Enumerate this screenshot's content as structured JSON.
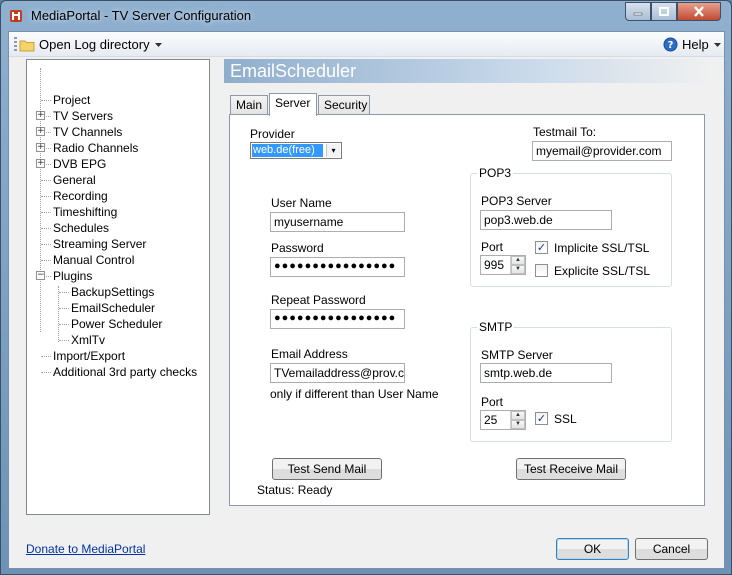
{
  "window": {
    "title": "MediaPortal - TV Server Configuration"
  },
  "menu": {
    "open_log": "Open Log directory",
    "help": "Help"
  },
  "tree": {
    "items": [
      {
        "label": "Project"
      },
      {
        "label": "TV Servers"
      },
      {
        "label": "TV Channels"
      },
      {
        "label": "Radio Channels"
      },
      {
        "label": "DVB EPG"
      },
      {
        "label": "General"
      },
      {
        "label": "Recording"
      },
      {
        "label": "Timeshifting"
      },
      {
        "label": "Schedules"
      },
      {
        "label": "Streaming Server"
      },
      {
        "label": "Manual Control"
      },
      {
        "label": "Plugins"
      },
      {
        "label": "BackupSettings"
      },
      {
        "label": "EmailScheduler"
      },
      {
        "label": "Power Scheduler"
      },
      {
        "label": "XmlTv"
      },
      {
        "label": "Import/Export"
      },
      {
        "label": "Additional 3rd party checks"
      }
    ]
  },
  "header": {
    "title": "EmailScheduler"
  },
  "tabs": [
    "Main",
    "Server",
    "Security"
  ],
  "server": {
    "provider_label": "Provider",
    "provider_value": "web.de(free)",
    "testmail_label": "Testmail To:",
    "testmail_value": "myemail@provider.com",
    "username_label": "User Name",
    "username_value": "myusername",
    "password_label": "Password",
    "password_value": "●●●●●●●●●●●●●●●●",
    "repeat_password_label": "Repeat Password",
    "repeat_password_value": "●●●●●●●●●●●●●●●●",
    "email_label": "Email Address",
    "email_value": "TVemailaddress@prov.com",
    "email_hint": "only if different than User Name",
    "pop3": {
      "group_title": "POP3",
      "server_label": "POP3 Server",
      "server_value": "pop3.web.de",
      "port_label": "Port",
      "port_value": "995",
      "implicit_ssl_label": "Implicite SSL/TSL",
      "implicit_ssl_checked": true,
      "explicit_ssl_label": "Explicite SSL/TSL",
      "explicit_ssl_checked": false
    },
    "smtp": {
      "group_title": "SMTP",
      "server_label": "SMTP Server",
      "server_value": "smtp.web.de",
      "port_label": "Port",
      "port_value": "25",
      "ssl_label": "SSL",
      "ssl_checked": true
    },
    "test_send_label": "Test Send Mail",
    "test_receive_label": "Test Receive Mail",
    "status_text": "Status: Ready"
  },
  "footer": {
    "donate_link": "Donate to MediaPortal",
    "ok_label": "OK",
    "cancel_label": "Cancel"
  },
  "icons": {
    "check": "✓"
  }
}
